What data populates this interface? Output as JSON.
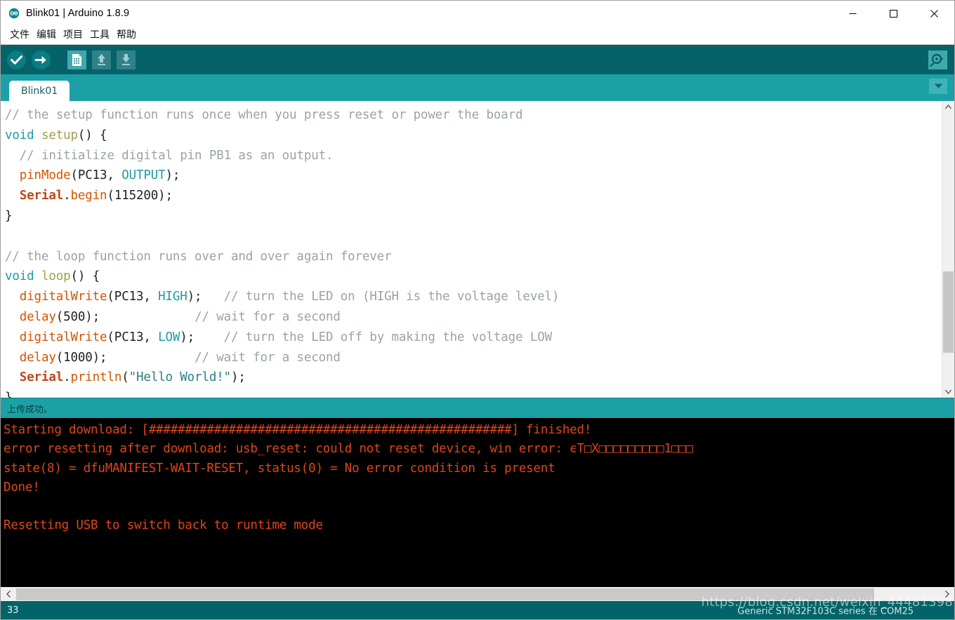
{
  "window": {
    "title": "Blink01 | Arduino 1.8.9",
    "logo_icon": "arduino-infinity-logo",
    "minimize_label": "—",
    "maximize_label": "□",
    "close_label": "✕"
  },
  "menubar": {
    "items": [
      {
        "label": "文件"
      },
      {
        "label": "编辑"
      },
      {
        "label": "项目"
      },
      {
        "label": "工具"
      },
      {
        "label": "帮助"
      }
    ]
  },
  "toolbar": {
    "buttons": [
      {
        "name": "verify-button",
        "icon": "check-circle-icon"
      },
      {
        "name": "upload-button",
        "icon": "arrow-right-circle-icon"
      },
      {
        "name": "new-sketch-button",
        "icon": "new-document-icon"
      },
      {
        "name": "open-sketch-button",
        "icon": "up-arrow-icon"
      },
      {
        "name": "save-sketch-button",
        "icon": "down-arrow-icon"
      }
    ],
    "serial_monitor": {
      "name": "serial-monitor-button",
      "icon": "magnifier-icon"
    }
  },
  "tabs": {
    "items": [
      {
        "label": "Blink01",
        "active": true
      }
    ],
    "dropdown_icon": "chevron-down-icon"
  },
  "editor": {
    "lines": [
      [
        {
          "t": "// the setup function runs once when you press reset or power the board",
          "c": "comment"
        }
      ],
      [
        {
          "t": "void",
          "c": "keyword"
        },
        {
          "t": " ",
          "c": "plain"
        },
        {
          "t": "setup",
          "c": "fnname"
        },
        {
          "t": "() {",
          "c": "plain"
        }
      ],
      [
        {
          "t": "  ",
          "c": "plain"
        },
        {
          "t": "// initialize digital pin PB1 as an output.",
          "c": "comment"
        }
      ],
      [
        {
          "t": "  ",
          "c": "plain"
        },
        {
          "t": "pinMode",
          "c": "func"
        },
        {
          "t": "(PC13, ",
          "c": "plain"
        },
        {
          "t": "OUTPUT",
          "c": "const"
        },
        {
          "t": ");",
          "c": "plain"
        }
      ],
      [
        {
          "t": "  ",
          "c": "plain"
        },
        {
          "t": "Serial",
          "c": "class"
        },
        {
          "t": ".",
          "c": "plain"
        },
        {
          "t": "begin",
          "c": "func"
        },
        {
          "t": "(115200);",
          "c": "plain"
        }
      ],
      [
        {
          "t": "}",
          "c": "plain"
        }
      ],
      [
        {
          "t": "",
          "c": "plain"
        }
      ],
      [
        {
          "t": "// the loop function runs over and over again forever",
          "c": "comment"
        }
      ],
      [
        {
          "t": "void",
          "c": "keyword"
        },
        {
          "t": " ",
          "c": "plain"
        },
        {
          "t": "loop",
          "c": "fnname"
        },
        {
          "t": "() {",
          "c": "plain"
        }
      ],
      [
        {
          "t": "  ",
          "c": "plain"
        },
        {
          "t": "digitalWrite",
          "c": "func"
        },
        {
          "t": "(PC13, ",
          "c": "plain"
        },
        {
          "t": "HIGH",
          "c": "const"
        },
        {
          "t": ");   ",
          "c": "plain"
        },
        {
          "t": "// turn the LED on (HIGH is the voltage level)",
          "c": "comment"
        }
      ],
      [
        {
          "t": "  ",
          "c": "plain"
        },
        {
          "t": "delay",
          "c": "func"
        },
        {
          "t": "(500);             ",
          "c": "plain"
        },
        {
          "t": "// wait for a second",
          "c": "comment"
        }
      ],
      [
        {
          "t": "  ",
          "c": "plain"
        },
        {
          "t": "digitalWrite",
          "c": "func"
        },
        {
          "t": "(PC13, ",
          "c": "plain"
        },
        {
          "t": "LOW",
          "c": "const"
        },
        {
          "t": ");    ",
          "c": "plain"
        },
        {
          "t": "// turn the LED off by making the voltage LOW",
          "c": "comment"
        }
      ],
      [
        {
          "t": "  ",
          "c": "plain"
        },
        {
          "t": "delay",
          "c": "func"
        },
        {
          "t": "(1000);            ",
          "c": "plain"
        },
        {
          "t": "// wait for a second",
          "c": "comment"
        }
      ],
      [
        {
          "t": "  ",
          "c": "plain"
        },
        {
          "t": "Serial",
          "c": "class"
        },
        {
          "t": ".",
          "c": "plain"
        },
        {
          "t": "println",
          "c": "func"
        },
        {
          "t": "(",
          "c": "plain"
        },
        {
          "t": "\"Hello World!\"",
          "c": "string"
        },
        {
          "t": ");",
          "c": "plain"
        }
      ],
      [
        {
          "t": "}",
          "c": "plain"
        }
      ]
    ]
  },
  "status_strip": {
    "message": "上传成功。"
  },
  "console": {
    "lines": [
      "Starting download: [##################################################] finished!",
      "error resetting after download: usb_reset: could not reset device, win error: ϵT□X□□□□□□□□□1□□□",
      "state(8) = dfuMANIFEST-WAIT-RESET, status(0) = No error condition is present",
      "Done!",
      "",
      "Resetting USB to switch back to runtime mode",
      ""
    ]
  },
  "statusbar": {
    "line_number": "33",
    "board_info": "Generic STM32F103C series 在 COM25"
  },
  "watermark": {
    "text": "https://blog.csdn.net/weixin_44481398"
  },
  "colors": {
    "toolbar_teal": "#056268",
    "tabbar_teal": "#1ba0a5",
    "statusbar_teal": "#006468",
    "console_bg": "#000000",
    "console_text": "#e0451a",
    "comment": "#9aa3a7",
    "keyword": "#1f9ca0",
    "function": "#d35400",
    "class": "#c0451a",
    "string": "#2a7d84"
  }
}
